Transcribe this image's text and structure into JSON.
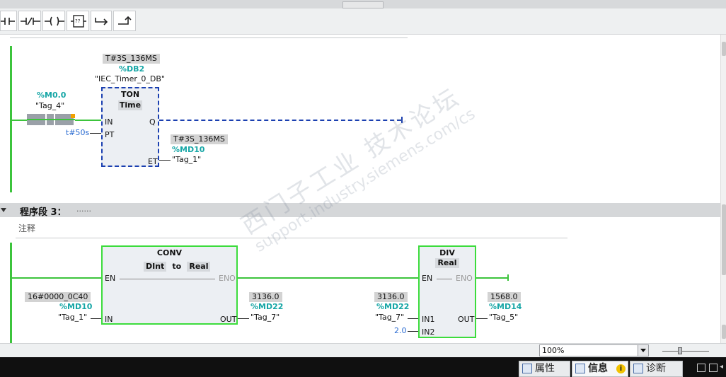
{
  "toolbar": {
    "items": [
      {
        "name": "no-contact-icon",
        "glyph": "⊣⊢"
      },
      {
        "name": "nc-contact-icon",
        "glyph": "⊣/⊢"
      },
      {
        "name": "coil-icon",
        "glyph": "–( )–"
      },
      {
        "name": "empty-box-icon",
        "glyph": "??"
      },
      {
        "name": "branch-open-icon",
        "glyph": "↦"
      },
      {
        "name": "branch-close-icon",
        "glyph": "↰"
      }
    ]
  },
  "network2": {
    "instance_value": "T#3S_136MS",
    "instance_addr": "%DB2",
    "instance_name": "\"IEC_Timer_0_DB\"",
    "block_name": "TON",
    "block_type": "Time",
    "pin_in": "IN",
    "pin_pt": "PT",
    "pin_q": "Q",
    "pin_et": "ET",
    "contact_addr": "%M0.0",
    "contact_tag": "\"Tag_4\"",
    "pt_value": "t#50s",
    "et_value": "T#3S_136MS",
    "et_addr": "%MD10",
    "et_tag": "\"Tag_1\""
  },
  "network3": {
    "label": "程序段 3：",
    "dots": "......",
    "comment": "注释",
    "conv": {
      "name": "CONV",
      "type_from": "DInt",
      "type_to_word": "to",
      "type_to": "Real",
      "pin_en": "EN",
      "pin_eno": "ENO",
      "pin_in": "IN",
      "pin_out": "OUT",
      "in_value": "16#0000_0C40",
      "in_addr": "%MD10",
      "in_tag": "\"Tag_1\"",
      "out_value": "3136.0",
      "out_addr": "%MD22",
      "out_tag": "\"Tag_7\""
    },
    "div": {
      "name": "DIV",
      "type": "Real",
      "pin_en": "EN",
      "pin_eno": "ENO",
      "pin_in1": "IN1",
      "pin_in2": "IN2",
      "pin_out": "OUT",
      "in1_value": "3136.0",
      "in1_addr": "%MD22",
      "in1_tag": "\"Tag_7\"",
      "in2_value": "2.0",
      "out_value": "1568.0",
      "out_addr": "%MD14",
      "out_tag": "\"Tag_5\""
    }
  },
  "status": {
    "zoom": "100%"
  },
  "bottom_tabs": {
    "properties": "属性",
    "info": "信息",
    "diagnostics": "诊断"
  },
  "watermark": {
    "cn": "西门子工业 技术论坛",
    "url": "support.industry.siemens.com/cs"
  },
  "colors": {
    "power_flow": "#3cc43c",
    "box_active_border": "#3cdc3c",
    "timer_border": "#1a3fb0",
    "address": "#16a6a6",
    "constant": "#2a6bd1"
  }
}
